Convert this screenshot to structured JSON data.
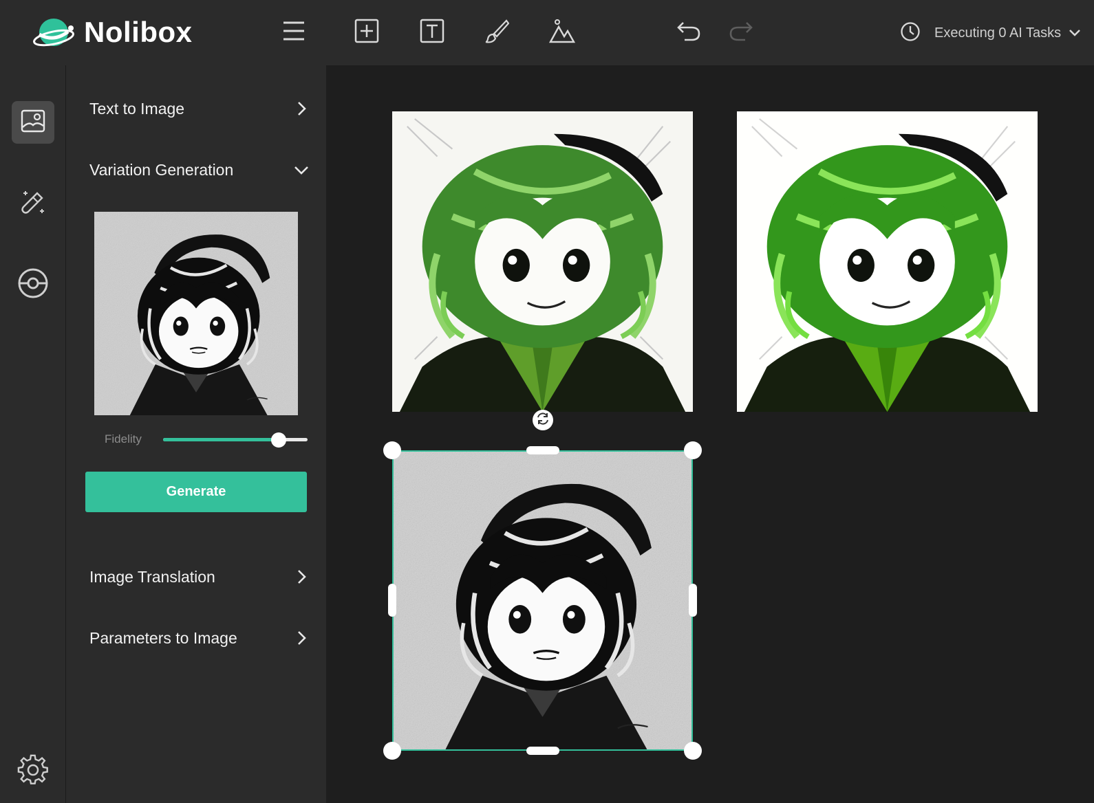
{
  "app": {
    "brand": "Nolibox",
    "accent_color": "#34c09b"
  },
  "toolbar": {
    "icons": [
      "menu-icon",
      "add-frame-icon",
      "text-icon",
      "brush-icon",
      "image-icon",
      "undo-icon",
      "redo-icon"
    ]
  },
  "status": {
    "icon": "clock-icon",
    "text": "Executing 0 AI Tasks"
  },
  "rail": {
    "items": [
      {
        "icon": "image-icon",
        "active": true
      },
      {
        "icon": "magic-wand-icon",
        "active": false
      },
      {
        "icon": "eye-icon",
        "active": false
      },
      {
        "icon": "settings-gear-icon",
        "active": false
      }
    ]
  },
  "panel": {
    "sections": [
      {
        "title": "Text to Image",
        "expanded": false
      },
      {
        "title": "Variation Generation",
        "expanded": true
      },
      {
        "title": "Image Translation",
        "expanded": false
      },
      {
        "title": "Parameters to Image",
        "expanded": false
      }
    ],
    "variation": {
      "fidelity_label": "Fidelity",
      "fidelity_value": 0.8,
      "generate_label": "Generate"
    }
  },
  "canvas": {
    "images": [
      {
        "name": "variation-green-1",
        "style": "green"
      },
      {
        "name": "variation-green-2",
        "style": "green"
      },
      {
        "name": "source-bw",
        "style": "bw",
        "selected": true
      }
    ]
  }
}
